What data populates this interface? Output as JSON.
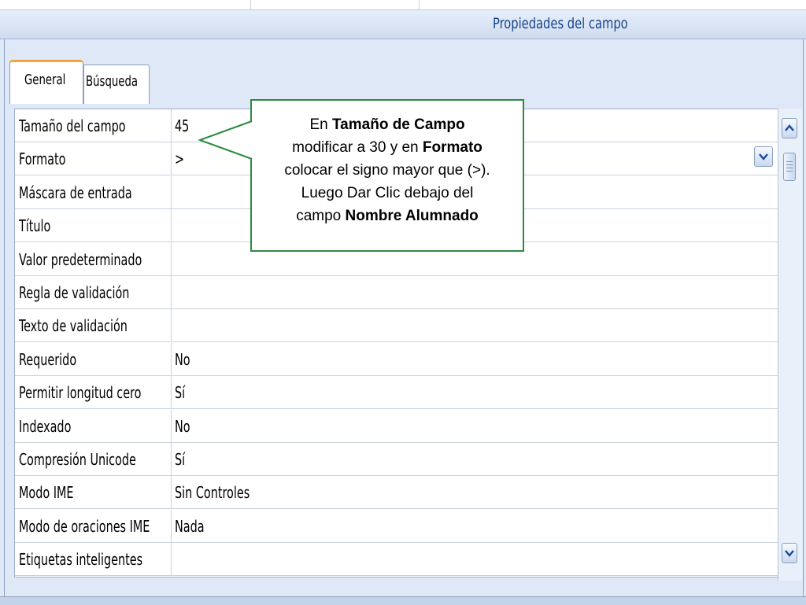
{
  "header": {
    "title": "Propiedades del campo"
  },
  "tabs": [
    {
      "label": "General",
      "active": true
    },
    {
      "label": "Búsqueda",
      "active": false
    }
  ],
  "properties": [
    {
      "label": "Tamaño del campo",
      "value": "45"
    },
    {
      "label": "Formato",
      "value": ">"
    },
    {
      "label": "Máscara de entrada",
      "value": ""
    },
    {
      "label": "Título",
      "value": ""
    },
    {
      "label": "Valor predeterminado",
      "value": ""
    },
    {
      "label": "Regla de validación",
      "value": ""
    },
    {
      "label": "Texto de validación",
      "value": ""
    },
    {
      "label": "Requerido",
      "value": "No"
    },
    {
      "label": "Permitir longitud cero",
      "value": "Sí"
    },
    {
      "label": "Indexado",
      "value": "No"
    },
    {
      "label": "Compresión Unicode",
      "value": "Sí"
    },
    {
      "label": "Modo IME",
      "value": "Sin Controles"
    },
    {
      "label": "Modo de oraciones IME",
      "value": "Nada"
    },
    {
      "label": "Etiquetas inteligentes",
      "value": ""
    }
  ],
  "callout": {
    "line1_a": "En ",
    "line1_b": "Tamaño de Campo",
    "line2_a": "modificar a 30 y en ",
    "line2_b": "Formato",
    "line3": "colocar el signo mayor que (>).",
    "line4": "Luego Dar Clic debajo del",
    "line5_a": "campo ",
    "line5_b": "Nombre Alumnado"
  },
  "icons": {
    "scroll_up": "chevron-up-icon",
    "scroll_down": "chevron-down-icon",
    "dropdown": "chevron-down-icon"
  },
  "colors": {
    "accent_tab": "#f0a63a",
    "callout_border": "#2e8b3e",
    "header_text": "#15428b"
  }
}
